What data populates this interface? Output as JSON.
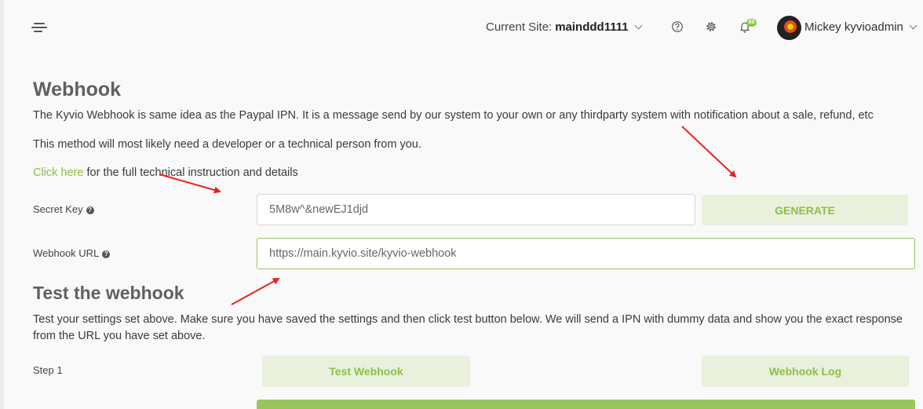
{
  "header": {
    "site_label": "Current Site:",
    "site_name": "mainddd1111",
    "notification_count": "89",
    "user_name": "Mickey kyvioadmin",
    "icons": [
      "menu-toggle-icon",
      "help-icon",
      "gear-icon",
      "bell-icon"
    ]
  },
  "webhook": {
    "title": "Webhook",
    "description": "The Kyvio Webhook is same idea as the Paypal IPN. It is a message send by our system to your own or any thirdparty system with notification about a sale, refund, etc",
    "developer_note": "This method will most likely need a developer or a technical person from you.",
    "link_text": "Click here",
    "link_suffix": " for the full technical instruction and details",
    "secret_key_label": "Secret Key",
    "secret_key_value": "5M8w^&newEJ1djd",
    "generate_label": "GENERATE",
    "webhook_url_label": "Webhook URL",
    "webhook_url_value": "https://main.kyvio.site/kyvio-webhook"
  },
  "test": {
    "title": "Test the webhook",
    "description": "Test your settings set above. Make sure you have saved the settings and then click test button below. We will send a IPN with dummy data and show you the exact response from the URL you have set above.",
    "step_label": "Step 1",
    "test_button_label": "Test Webhook",
    "log_button_label": "Webhook Log"
  },
  "colors": {
    "accent": "#8cc04a",
    "button_bg": "#e9f0dc",
    "annotation_arrow": "#e52420"
  }
}
